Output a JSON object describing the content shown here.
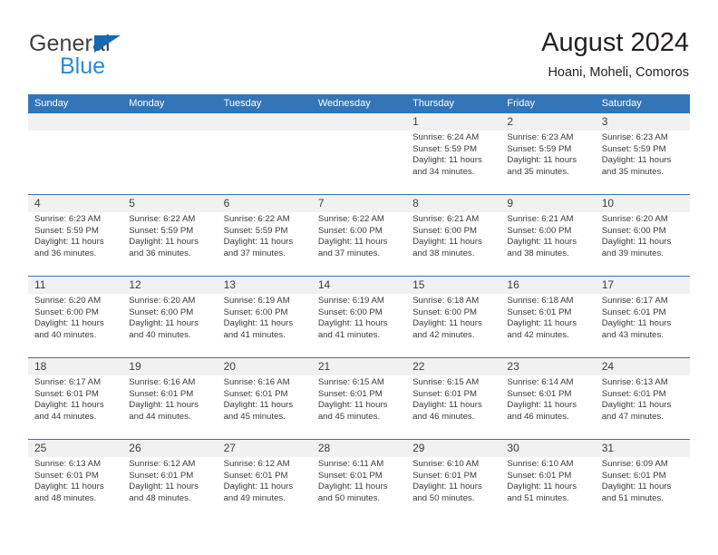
{
  "brand": {
    "name_part1": "General",
    "name_part2": "Blue",
    "triangle_color": "#1668b3",
    "text_color": "#3f3f3f",
    "blue_text_color": "#2b8ad6"
  },
  "header": {
    "title": "August 2024",
    "subtitle": "Hoani, Moheli, Comoros"
  },
  "theme": {
    "header_blue": "#3275b8",
    "daynum_band": "#f1f1f1",
    "text": "#3a3a3a"
  },
  "weekdays": [
    "Sunday",
    "Monday",
    "Tuesday",
    "Wednesday",
    "Thursday",
    "Friday",
    "Saturday"
  ],
  "weeks": [
    {
      "days": [
        {
          "num": "",
          "info": "",
          "empty": true
        },
        {
          "num": "",
          "info": "",
          "empty": true
        },
        {
          "num": "",
          "info": "",
          "empty": true
        },
        {
          "num": "",
          "info": "",
          "empty": true
        },
        {
          "num": "1",
          "info": "Sunrise: 6:24 AM\nSunset: 5:59 PM\nDaylight: 11 hours\nand 34 minutes.",
          "empty": false
        },
        {
          "num": "2",
          "info": "Sunrise: 6:23 AM\nSunset: 5:59 PM\nDaylight: 11 hours\nand 35 minutes.",
          "empty": false
        },
        {
          "num": "3",
          "info": "Sunrise: 6:23 AM\nSunset: 5:59 PM\nDaylight: 11 hours\nand 35 minutes.",
          "empty": false
        }
      ]
    },
    {
      "days": [
        {
          "num": "4",
          "info": "Sunrise: 6:23 AM\nSunset: 5:59 PM\nDaylight: 11 hours\nand 36 minutes.",
          "empty": false
        },
        {
          "num": "5",
          "info": "Sunrise: 6:22 AM\nSunset: 5:59 PM\nDaylight: 11 hours\nand 36 minutes.",
          "empty": false
        },
        {
          "num": "6",
          "info": "Sunrise: 6:22 AM\nSunset: 5:59 PM\nDaylight: 11 hours\nand 37 minutes.",
          "empty": false
        },
        {
          "num": "7",
          "info": "Sunrise: 6:22 AM\nSunset: 6:00 PM\nDaylight: 11 hours\nand 37 minutes.",
          "empty": false
        },
        {
          "num": "8",
          "info": "Sunrise: 6:21 AM\nSunset: 6:00 PM\nDaylight: 11 hours\nand 38 minutes.",
          "empty": false
        },
        {
          "num": "9",
          "info": "Sunrise: 6:21 AM\nSunset: 6:00 PM\nDaylight: 11 hours\nand 38 minutes.",
          "empty": false
        },
        {
          "num": "10",
          "info": "Sunrise: 6:20 AM\nSunset: 6:00 PM\nDaylight: 11 hours\nand 39 minutes.",
          "empty": false
        }
      ]
    },
    {
      "days": [
        {
          "num": "11",
          "info": "Sunrise: 6:20 AM\nSunset: 6:00 PM\nDaylight: 11 hours\nand 40 minutes.",
          "empty": false
        },
        {
          "num": "12",
          "info": "Sunrise: 6:20 AM\nSunset: 6:00 PM\nDaylight: 11 hours\nand 40 minutes.",
          "empty": false
        },
        {
          "num": "13",
          "info": "Sunrise: 6:19 AM\nSunset: 6:00 PM\nDaylight: 11 hours\nand 41 minutes.",
          "empty": false
        },
        {
          "num": "14",
          "info": "Sunrise: 6:19 AM\nSunset: 6:00 PM\nDaylight: 11 hours\nand 41 minutes.",
          "empty": false
        },
        {
          "num": "15",
          "info": "Sunrise: 6:18 AM\nSunset: 6:00 PM\nDaylight: 11 hours\nand 42 minutes.",
          "empty": false
        },
        {
          "num": "16",
          "info": "Sunrise: 6:18 AM\nSunset: 6:01 PM\nDaylight: 11 hours\nand 42 minutes.",
          "empty": false
        },
        {
          "num": "17",
          "info": "Sunrise: 6:17 AM\nSunset: 6:01 PM\nDaylight: 11 hours\nand 43 minutes.",
          "empty": false
        }
      ]
    },
    {
      "days": [
        {
          "num": "18",
          "info": "Sunrise: 6:17 AM\nSunset: 6:01 PM\nDaylight: 11 hours\nand 44 minutes.",
          "empty": false
        },
        {
          "num": "19",
          "info": "Sunrise: 6:16 AM\nSunset: 6:01 PM\nDaylight: 11 hours\nand 44 minutes.",
          "empty": false
        },
        {
          "num": "20",
          "info": "Sunrise: 6:16 AM\nSunset: 6:01 PM\nDaylight: 11 hours\nand 45 minutes.",
          "empty": false
        },
        {
          "num": "21",
          "info": "Sunrise: 6:15 AM\nSunset: 6:01 PM\nDaylight: 11 hours\nand 45 minutes.",
          "empty": false
        },
        {
          "num": "22",
          "info": "Sunrise: 6:15 AM\nSunset: 6:01 PM\nDaylight: 11 hours\nand 46 minutes.",
          "empty": false
        },
        {
          "num": "23",
          "info": "Sunrise: 6:14 AM\nSunset: 6:01 PM\nDaylight: 11 hours\nand 46 minutes.",
          "empty": false
        },
        {
          "num": "24",
          "info": "Sunrise: 6:13 AM\nSunset: 6:01 PM\nDaylight: 11 hours\nand 47 minutes.",
          "empty": false
        }
      ]
    },
    {
      "days": [
        {
          "num": "25",
          "info": "Sunrise: 6:13 AM\nSunset: 6:01 PM\nDaylight: 11 hours\nand 48 minutes.",
          "empty": false
        },
        {
          "num": "26",
          "info": "Sunrise: 6:12 AM\nSunset: 6:01 PM\nDaylight: 11 hours\nand 48 minutes.",
          "empty": false
        },
        {
          "num": "27",
          "info": "Sunrise: 6:12 AM\nSunset: 6:01 PM\nDaylight: 11 hours\nand 49 minutes.",
          "empty": false
        },
        {
          "num": "28",
          "info": "Sunrise: 6:11 AM\nSunset: 6:01 PM\nDaylight: 11 hours\nand 50 minutes.",
          "empty": false
        },
        {
          "num": "29",
          "info": "Sunrise: 6:10 AM\nSunset: 6:01 PM\nDaylight: 11 hours\nand 50 minutes.",
          "empty": false
        },
        {
          "num": "30",
          "info": "Sunrise: 6:10 AM\nSunset: 6:01 PM\nDaylight: 11 hours\nand 51 minutes.",
          "empty": false
        },
        {
          "num": "31",
          "info": "Sunrise: 6:09 AM\nSunset: 6:01 PM\nDaylight: 11 hours\nand 51 minutes.",
          "empty": false
        }
      ]
    }
  ]
}
